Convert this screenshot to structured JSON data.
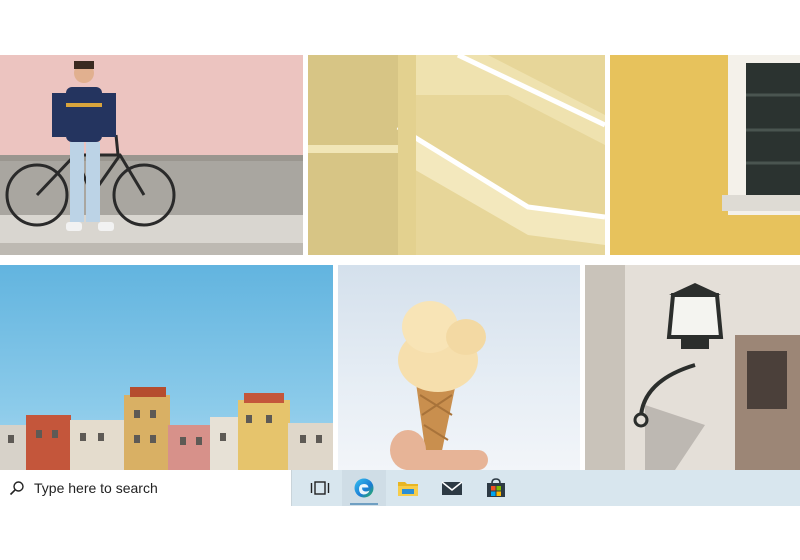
{
  "taskbar": {
    "search": {
      "placeholder": "Type here to search",
      "icon": "search-icon"
    },
    "buttons": [
      {
        "name": "task-view",
        "icon": "task-view-icon"
      },
      {
        "name": "edge",
        "icon": "edge-icon",
        "active": true
      },
      {
        "name": "file-explorer",
        "icon": "folder-icon"
      },
      {
        "name": "mail",
        "icon": "mail-icon"
      },
      {
        "name": "store",
        "icon": "store-icon"
      }
    ]
  },
  "photos": [
    {
      "name": "photo-man-with-bicycle"
    },
    {
      "name": "photo-yellow-staircase"
    },
    {
      "name": "photo-yellow-wall-window"
    },
    {
      "name": "photo-colorful-buildings-sky"
    },
    {
      "name": "photo-ice-cream-cone"
    },
    {
      "name": "photo-wall-street-lamp"
    }
  ],
  "colors": {
    "taskbar_bg": "#d8e6ee",
    "search_bg": "#ffffff",
    "active_indicator": "#6f9fc2"
  }
}
